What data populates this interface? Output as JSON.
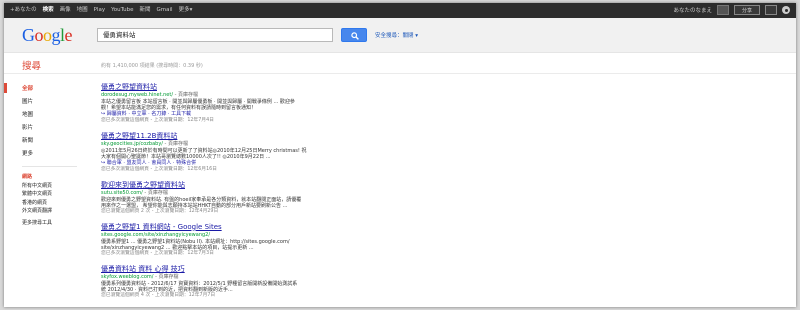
{
  "topbar": {
    "items": [
      "+あなたの",
      "検索",
      "画像",
      "地圖",
      "Play",
      "YouTube",
      "新聞",
      "Gmail",
      "更多▾"
    ],
    "user_name": "あなたのなまえ",
    "share_label": "分享"
  },
  "header": {
    "logo": [
      "G",
      "o",
      "o",
      "g",
      "l",
      "e"
    ],
    "search_value": "優勇資料站",
    "safesearch": "安全搜尋：關閉 ▾"
  },
  "search_label": "搜尋",
  "stats": "約有 1,410,000 項結果 (搜尋時間：0.39 秒)",
  "sidebar": {
    "nav": [
      "全部",
      "圖片",
      "地圖",
      "影片",
      "新聞",
      "更多"
    ],
    "filters": [
      "網路",
      "所有中文網頁",
      "繁體中文網頁",
      "香港的網頁",
      "外文網頁翻譯",
      "更多搜尋工具"
    ]
  },
  "results": [
    {
      "title": "優勇之野望資料站",
      "url": "dorodesug.myweb.hinet.net/",
      "cached": " - 頁庫存檔",
      "snippet": [
        "本站之優勇留言板 本站留言板 · 開並與歸屬優勇板 · 開並與歸屬 · 開戰爭條例 ... 歡迎參",
        "觀！希望本站能滿足您的需求，有任何資料有誤請隨時到留言板通知！"
      ],
      "links": "↪ 歸屬資料 · 中立軍 · 名刀錄 · 工具下載",
      "meta": "您已多次瀏覽這個網頁 - 上次瀏覽日期：12年7月4日"
    },
    {
      "title": "優勇之野望11.2B資料站",
      "url": "sky.geocities.jp/cozbaby/",
      "cached": " - 頁庫存檔",
      "snippet": [
        "◎2011年5月26日終於有時間可以更新了了資料站◎2010年12月25日Merry christmas! 祝",
        "大家有個開心聖誕節！本站哥瀏覽總數10000人次了!! ◎2010年9月22日 ..."
      ],
      "links": "↪ 聯合軍 · 盟友同人 · 會員同人 · 特殊合併",
      "meta": "您已多次瀏覽這個網頁 - 上次瀏覽日期：12年6月16日"
    },
    {
      "title": "歡迎來到優勇之野望資料站",
      "url": "sutu.site50.com/",
      "cached": " - 頁庫存檔",
      "snippet": [
        "歡迎來到優勇之野望資料站. 有盤的hoeil家奉承是各分類資料，就本站翻閱正面站，請優覆",
        "用來作之一選盟， 希望你能與志願持本站站HHKT自動的部分用戶新站要刷新公告 ..."
      ],
      "links": "",
      "meta": "您已瀏覽這個網頁 2 次 - 上次瀏覽日期：12年4月29日"
    },
    {
      "title": "優勇之野望1 資料網站 - Google Sites",
      "url": "sites.google.com/site/xinzhangyicyewang2/",
      "cached": "",
      "snippet": [
        "優勇系野望1 ... 優勇之野望1資料站(Nobu II). 本站網址：http://sites.google.com/",
        "site/xinzhangyicyewang2 ... 歡迎點擊本站的項目，站提示更新 ..."
      ],
      "links": "",
      "meta": "您已多次瀏覽這個網頁 - 上次瀏覽日期：12年7月3日"
    },
    {
      "title": "優勇資料站 資料 心得 技巧",
      "url": "skyfox.weeblog.com/",
      "cached": " - 頁庫存檔",
      "snippet": [
        "優勇系列優勇資料站 - 2012/6/17 資寶資料：2012/5/1 野種留言版開新設備開始測試系",
        "統 2012/4/30 · 資料已打到的近，把資料翻到新版的近手... "
      ],
      "links": "",
      "meta": "您已瀏覽這個網頁 4 次 - 上次瀏覽日期：12年7月7日"
    }
  ]
}
